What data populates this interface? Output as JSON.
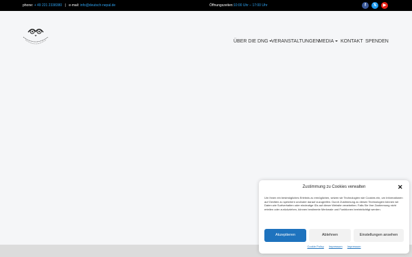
{
  "topbar": {
    "phone_label": "phone:",
    "phone_value": "+ 49 221 2338380",
    "separator": "|",
    "email_label": "e-mail:",
    "email_value": "info@deutsch-nepal.de",
    "hours_label": "Öffnungszeiten:",
    "hours_value": "10:00 Uhr – 17:00 Uhr",
    "social": [
      {
        "icon": "facebook-icon",
        "glyph": "f"
      },
      {
        "icon": "x-icon",
        "glyph": "𝕏"
      },
      {
        "icon": "youtube-icon",
        "glyph": "▶"
      }
    ]
  },
  "nav": {
    "items": [
      {
        "label": "ÜBER DIE DNG",
        "dropdown": true
      },
      {
        "label": "VERANSTALTUNGEN",
        "dropdown": false
      },
      {
        "label": "MEDIA",
        "dropdown": true
      },
      {
        "label": "KONTAKT",
        "dropdown": false
      },
      {
        "label": "SPENDEN",
        "dropdown": false
      }
    ]
  },
  "cookie": {
    "title": "Zustimmung zu Cookies verwalten",
    "close_glyph": "✕",
    "text": "Um Ihnen ein bestmögliches Erlebnis zu ermöglichen, setzen wir Technologien wie Cookies ein, um Informationen auf Geräten zu speichern und/oder darauf zuzugreifen. Durch Zustimmung zu diesen Technologien können wir Daten wie Surfverhalten oder eindeutige IDs auf dieser Website verarbeiten. Falls Sie Ihre Zustimmung nicht erteilen oder zurückziehen, können bestimmte Merkmale und Funktionen beeinträchtigt werden.",
    "accept": "Akzeptieren",
    "reject": "Ablehnen",
    "settings": "Einstellungen ansehen",
    "links": [
      "Cookie Policy",
      "Impressum",
      "Impressum"
    ]
  },
  "colors": {
    "accent": "#2ea3f2",
    "button_primary": "#1e73be",
    "topbar": "#000000"
  }
}
